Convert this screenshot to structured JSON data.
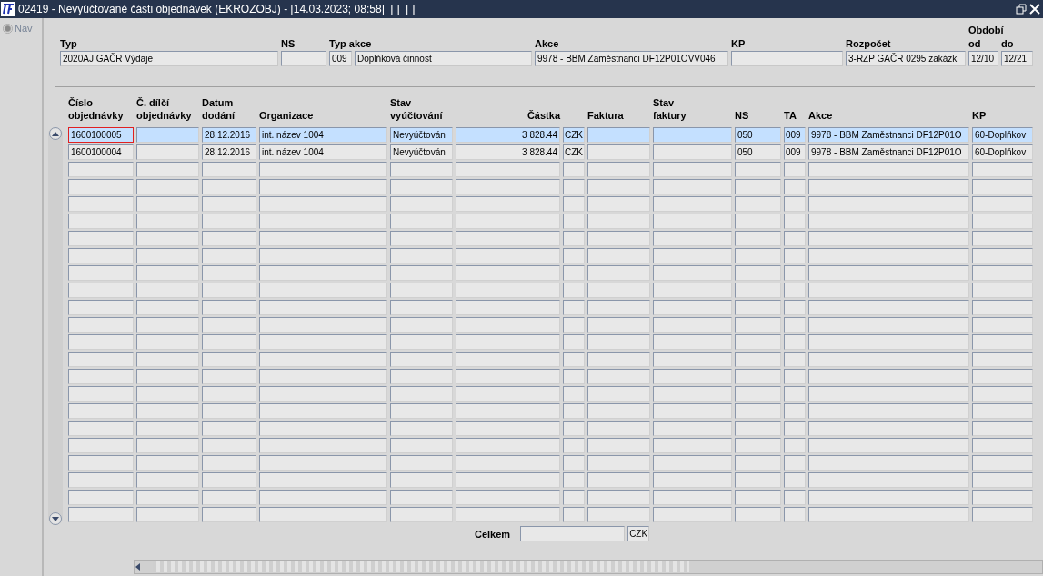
{
  "window": {
    "title": "02419 - Nevyúčtované části objednávek (EKROZOBJ) - [14.03.2023; 08:58]  [ ]  [ ]"
  },
  "nav": {
    "label": "Nav",
    "disabled": true
  },
  "filter": {
    "fields": [
      {
        "label": "Typ",
        "value": "2020AJ GAČR Výdaje"
      },
      {
        "label": "NS"
      },
      {
        "label": "Typ akce",
        "value": "009"
      },
      {
        "value": "Doplňková činnost"
      },
      {
        "label": "Akce",
        "value": "9978 - BBM Zaměstnanci DF12P01OVV046"
      },
      {
        "label": "KP"
      },
      {
        "label": "Rozpočet",
        "value": "3-RZP GAČR 0295 zakázk"
      },
      {
        "label": "od",
        "value": "12/10"
      },
      {
        "label": "do",
        "value": "12/21"
      }
    ],
    "period_label": "Období"
  },
  "table": {
    "columns": [
      {
        "label": "Číslo\nobjednávky"
      },
      {
        "label": "Č. dílčí\nobjednávky"
      },
      {
        "label": "Datum\ndodání"
      },
      {
        "label": "Organizace"
      },
      {
        "label": "Stav\nvyúčtování"
      },
      {
        "label": "Částka"
      },
      {},
      {
        "label": "Faktura"
      },
      {
        "label": "Stav\nfaktury"
      },
      {
        "label": "NS"
      },
      {
        "label": "TA"
      },
      {
        "label": "Akce"
      },
      {
        "label": "KP"
      }
    ],
    "rows": [
      {
        "selected": true,
        "focused": true,
        "cells": [
          "1600100005",
          null,
          "28.12.2016",
          "int. název 1004",
          "Nevyúčtován",
          "3 828.44",
          "CZK",
          null,
          null,
          "050",
          "009",
          "9978 - BBM Zaměstnanci DF12P01O",
          "60-Doplňkov"
        ]
      },
      {
        "selected": false,
        "focused": false,
        "cells": [
          "1600100004",
          null,
          "28.12.2016",
          "int. název 1004",
          "Nevyúčtován",
          "3 828.44",
          "CZK",
          null,
          null,
          "050",
          "009",
          "9978 - BBM Zaměstnanci DF12P01O",
          "60-Doplňkov"
        ]
      }
    ]
  },
  "total": {
    "label": "Celkem",
    "currency": "CZK"
  }
}
